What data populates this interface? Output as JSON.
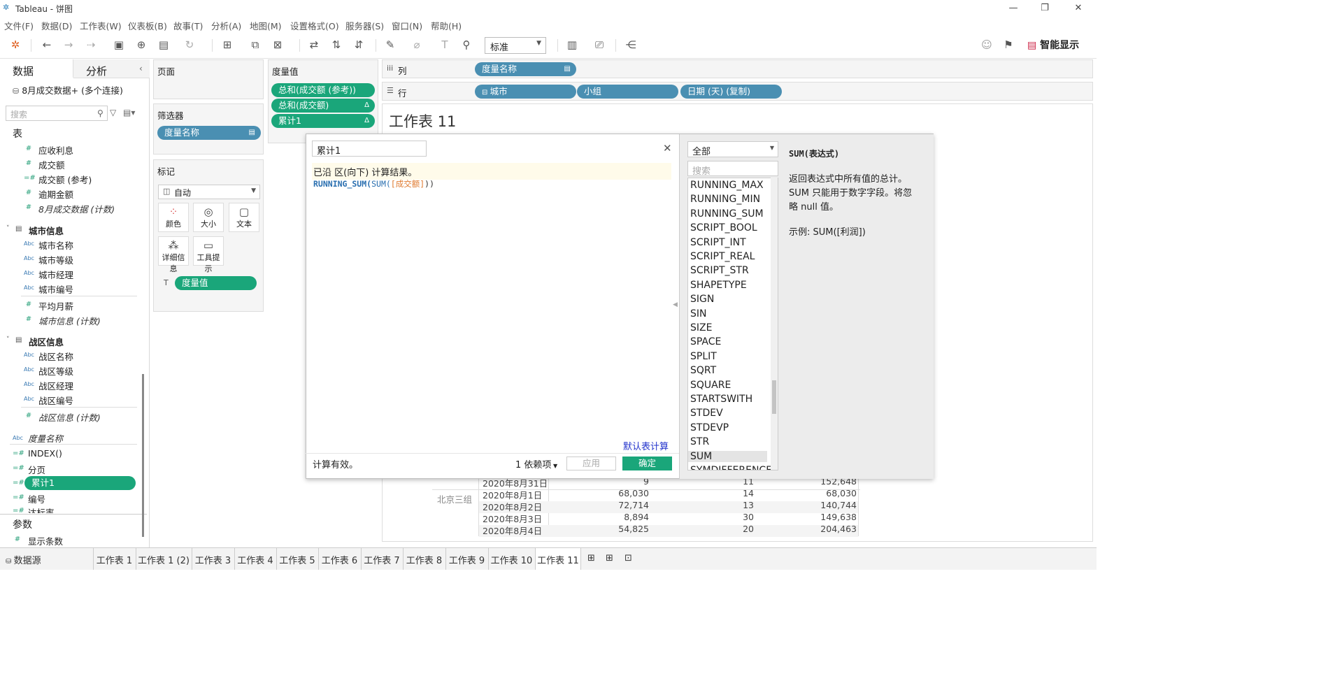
{
  "window": {
    "title": "Tableau - 饼图"
  },
  "menu": [
    "文件(F)",
    "数据(D)",
    "工作表(W)",
    "仪表板(B)",
    "故事(T)",
    "分析(A)",
    "地图(M)",
    "设置格式(O)",
    "服务器(S)",
    "窗口(N)",
    "帮助(H)"
  ],
  "toolbar": {
    "fit": "标准",
    "smart": "智能显示"
  },
  "datapane": {
    "tab_data": "数据",
    "tab_analysis": "分析",
    "connection": "8月成交数据+ (多个连接)",
    "search_placeholder": "搜索",
    "section_table": "表",
    "fields_top": [
      "应收利息",
      "成交额",
      "成交额 (参考)",
      "逾期金额",
      "8月成交数据 (计数)"
    ],
    "group_city": "城市信息",
    "city_fields": [
      "城市名称",
      "城市等级",
      "城市经理",
      "城市编号"
    ],
    "city_measures": [
      "平均月薪",
      "城市信息 (计数)"
    ],
    "group_zone": "战区信息",
    "zone_fields": [
      "战区名称",
      "战区等级",
      "战区经理",
      "战区编号"
    ],
    "zone_measure": "战区信息 (计数)",
    "misc": [
      "度量名称",
      "INDEX()",
      "分页",
      "累计1",
      "编号",
      "达标率"
    ],
    "section_params": "参数",
    "param": "显示条数"
  },
  "shelves": {
    "pages": "页面",
    "filters": "筛选器",
    "filter_pill": "度量名称",
    "marks": "标记",
    "mark_type": "自动",
    "mark_buttons": [
      "颜色",
      "大小",
      "文本",
      "详细信息",
      "工具提示"
    ],
    "mark_pill": "度量值",
    "measure_values": "度量值",
    "mv_pills": [
      "总和(成交额 (参考))",
      "总和(成交额)",
      "累计1"
    ],
    "columns": "列",
    "rows": "行",
    "col_pills": [
      "度量名称"
    ],
    "row_pills": [
      "城市",
      "小组",
      "日期 (天) (复制)"
    ]
  },
  "sheet": {
    "title": "工作表 11"
  },
  "calc": {
    "name": "累计1",
    "note": "已沿 区(向下) 计算结果。",
    "code_fn": "RUNNING_SUM(",
    "code_inner": "SUM(",
    "code_field": "[成交额]",
    "code_close": "))",
    "default_table_calc": "默认表计算",
    "status": "计算有效。",
    "deps": "1 依赖项",
    "apply": "应用",
    "ok": "确定",
    "category": "全部",
    "func_search": "搜索",
    "functions": [
      "RUNNING_MAX",
      "RUNNING_MIN",
      "RUNNING_SUM",
      "SCRIPT_BOOL",
      "SCRIPT_INT",
      "SCRIPT_REAL",
      "SCRIPT_STR",
      "SHAPETYPE",
      "SIGN",
      "SIN",
      "SIZE",
      "SPACE",
      "SPLIT",
      "SQRT",
      "SQUARE",
      "STARTSWITH",
      "STDEV",
      "STDEVP",
      "STR",
      "SUM",
      "SYMDIFFERENCE"
    ],
    "help_sig": "SUM(表达式)",
    "help_text1": "返回表达式中所有值的总计。",
    "help_text2": "SUM 只能用于数字字段。将忽",
    "help_text3": "略 null 值。",
    "help_example": "示例: SUM([利润])"
  },
  "table": {
    "group2": "北京三组",
    "rows": [
      {
        "date": "2020年8月31日",
        "a": "9",
        "b": "11",
        "c": "152,648"
      },
      {
        "date": "2020年8月1日",
        "a": "68,030",
        "b": "14",
        "c": "68,030"
      },
      {
        "date": "2020年8月2日",
        "a": "72,714",
        "b": "13",
        "c": "140,744"
      },
      {
        "date": "2020年8月3日",
        "a": "8,894",
        "b": "30",
        "c": "149,638"
      },
      {
        "date": "2020年8月4日",
        "a": "54,825",
        "b": "20",
        "c": "204,463"
      }
    ]
  },
  "tabs": {
    "datasource": "数据源",
    "sheets": [
      "工作表 1",
      "工作表 1 (2)",
      "工作表 3",
      "工作表 4",
      "工作表 5",
      "工作表 6",
      "工作表 7",
      "工作表 8",
      "工作表 9",
      "工作表 10",
      "工作表 11"
    ]
  },
  "colors": {
    "pill_blue": "#4a8fb2",
    "pill_green": "#1aa67a"
  }
}
